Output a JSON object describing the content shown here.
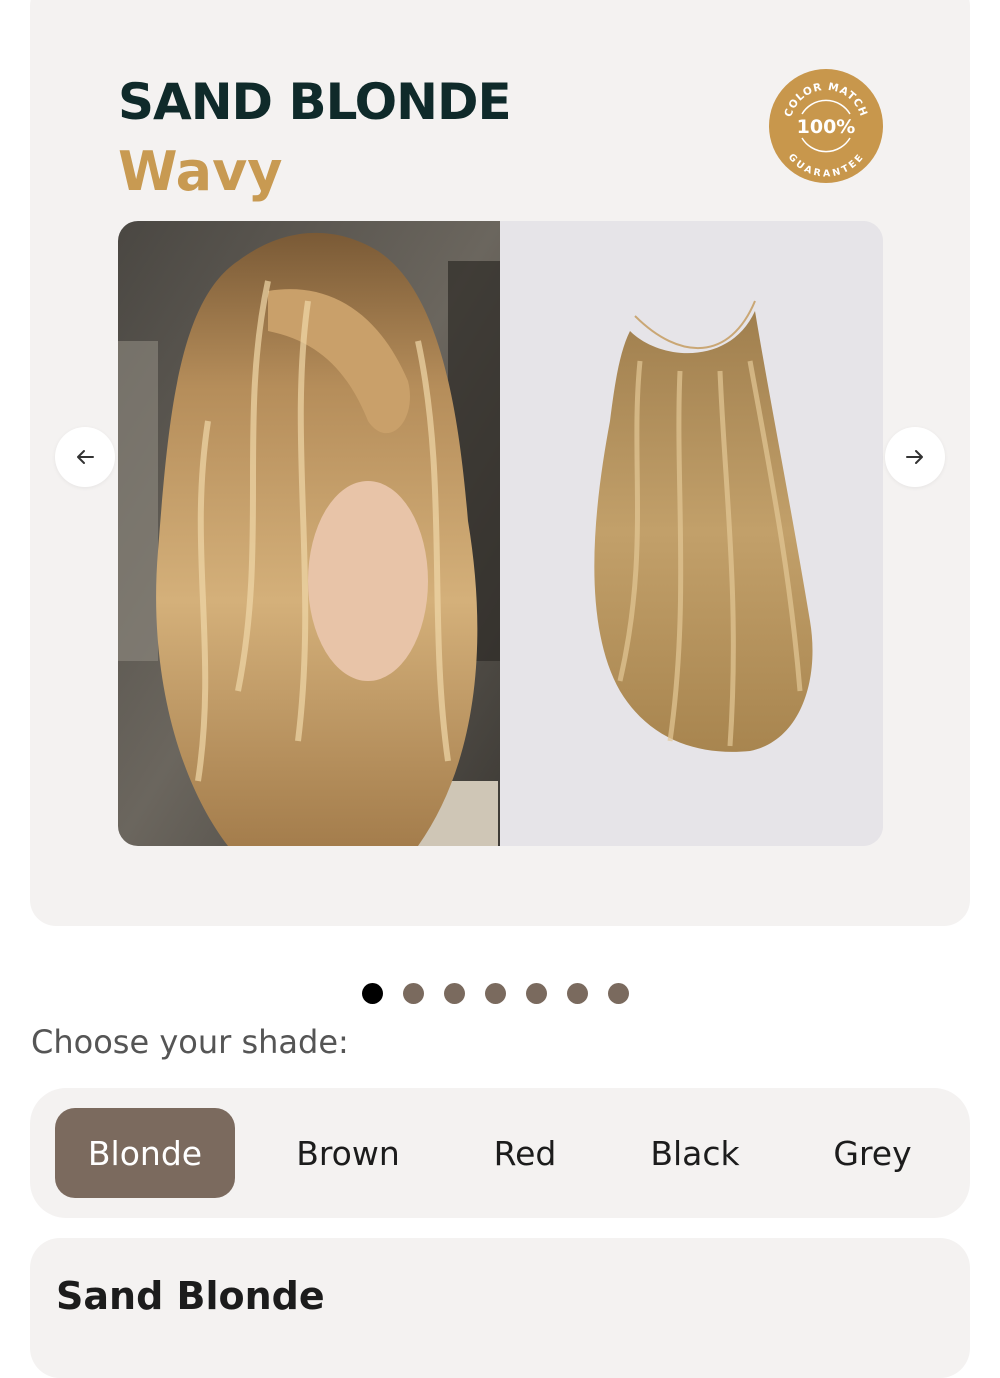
{
  "product": {
    "title": "SAND BLONDE",
    "subtitle": "Wavy"
  },
  "badge": {
    "top_text": "COLOR MATCH",
    "center_text": "100%",
    "bottom_text": "GUARANTEE",
    "color": "#c8974c"
  },
  "gallery": {
    "images": [
      "model-with-long-wavy-blonde-hair",
      "halo-hair-extension-product"
    ],
    "prev_icon": "arrow-left-icon",
    "next_icon": "arrow-right-icon",
    "slide_count": 7,
    "active_slide": 1
  },
  "shade_picker": {
    "label": "Choose your shade:",
    "options": [
      "Blonde",
      "Brown",
      "Red",
      "Black",
      "Grey"
    ],
    "selected": "Blonde",
    "selected_color": "#7b6a5e"
  },
  "shade_detail": {
    "title": "Sand Blonde"
  },
  "colors": {
    "heading": "#0f2a2a",
    "accent": "#c89a52",
    "card_bg": "#f4f2f1"
  }
}
